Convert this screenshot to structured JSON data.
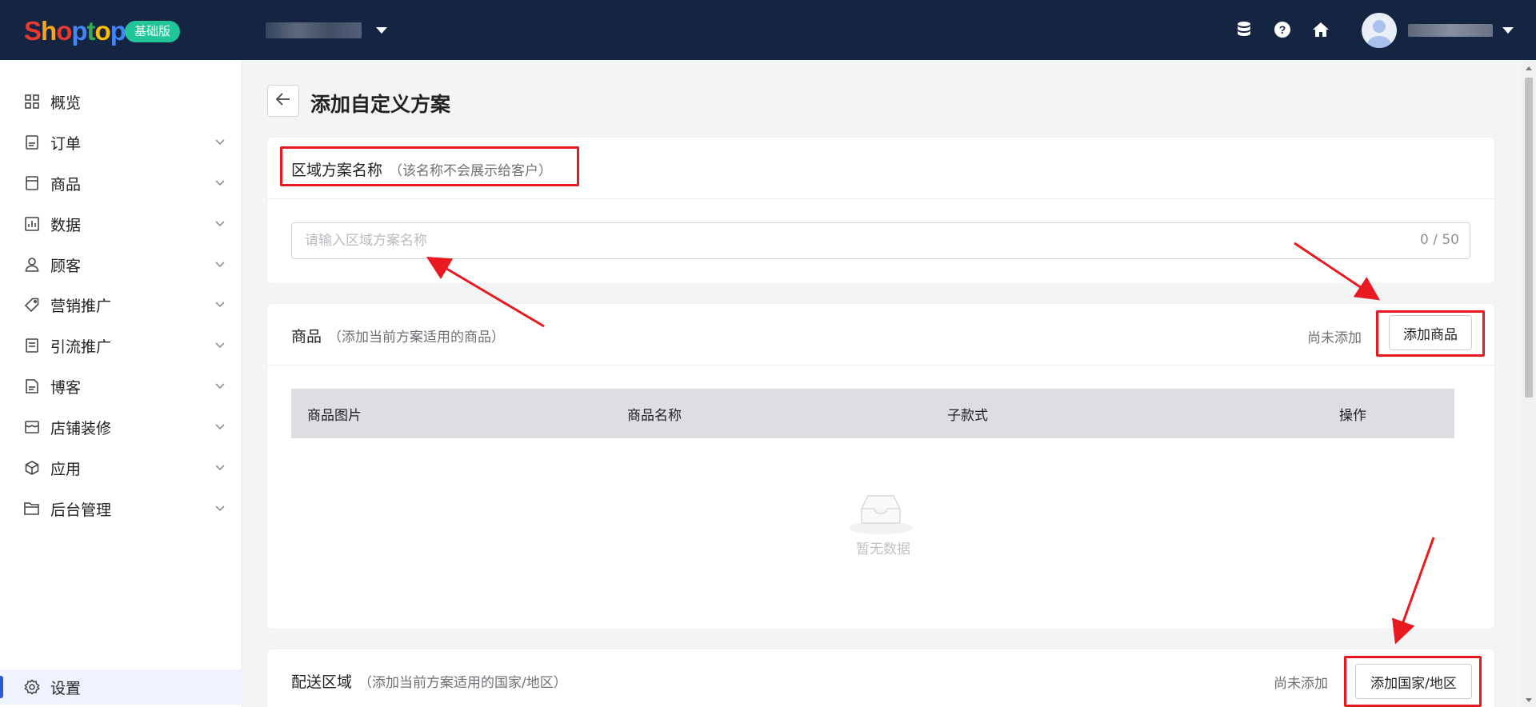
{
  "header": {
    "logo_text": "Shoptop",
    "edition_badge": "基础版",
    "icons": [
      "database-icon",
      "help-icon",
      "home-icon"
    ]
  },
  "sidebar": {
    "items": [
      {
        "label": "概览",
        "icon": "dashboard-grid-icon",
        "has_children": false
      },
      {
        "label": "订单",
        "icon": "order-doc-icon",
        "has_children": true
      },
      {
        "label": "商品",
        "icon": "product-box-icon",
        "has_children": true
      },
      {
        "label": "数据",
        "icon": "chart-icon",
        "has_children": true
      },
      {
        "label": "顾客",
        "icon": "user-icon",
        "has_children": true
      },
      {
        "label": "营销推广",
        "icon": "tag-icon",
        "has_children": true
      },
      {
        "label": "引流推广",
        "icon": "traffic-doc-icon",
        "has_children": true
      },
      {
        "label": "博客",
        "icon": "blog-doc-icon",
        "has_children": true
      },
      {
        "label": "店铺装修",
        "icon": "store-icon",
        "has_children": true
      },
      {
        "label": "应用",
        "icon": "cube-icon",
        "has_children": true
      },
      {
        "label": "后台管理",
        "icon": "folder-icon",
        "has_children": true
      }
    ],
    "settings_label": "设置"
  },
  "main": {
    "title": "添加自定义方案",
    "name_section": {
      "title": "区域方案名称",
      "subtitle": "（该名称不会展示给客户）",
      "placeholder": "请输入区域方案名称",
      "counter": "0 / 50"
    },
    "product_section": {
      "title": "商品",
      "subtitle": "（添加当前方案适用的商品）",
      "status": "尚未添加",
      "button": "添加商品",
      "columns": [
        "商品图片",
        "商品名称",
        "子款式",
        "操作"
      ],
      "empty_text": "暂无数据"
    },
    "delivery_section": {
      "title": "配送区域",
      "subtitle": "（添加当前方案适用的国家/地区）",
      "status": "尚未添加",
      "button": "添加国家/地区"
    }
  },
  "colors": {
    "topbar": "#142441",
    "edition_badge": "#20c59a",
    "annotation_red": "#e8191f",
    "active_blue": "#2a5bd7"
  }
}
